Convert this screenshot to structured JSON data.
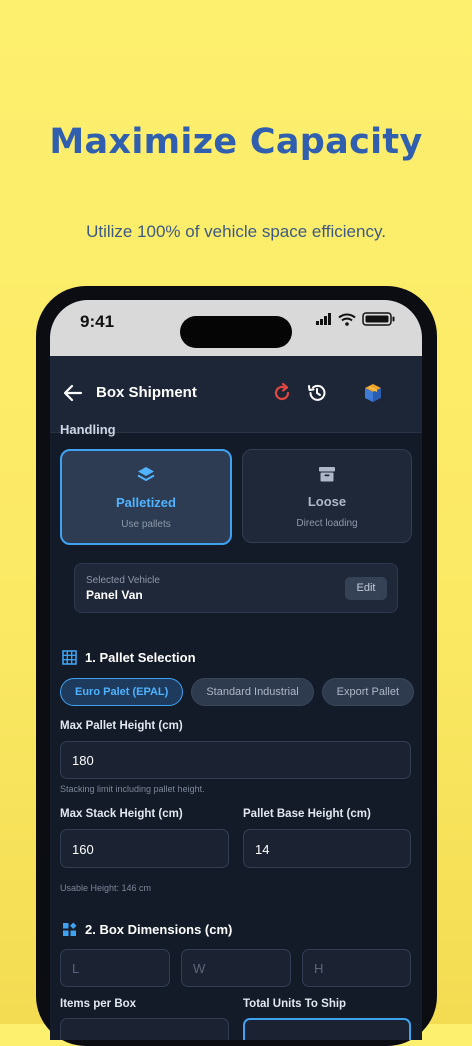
{
  "promo": {
    "headline": "Maximize Capacity",
    "subline": "Utilize 100% of vehicle space efficiency."
  },
  "status_bar": {
    "time": "9:41"
  },
  "app_bar": {
    "title": "Box Shipment",
    "icons": [
      "back-arrow-icon",
      "refresh-icon",
      "history-icon",
      "boxes-logo-icon"
    ],
    "accent_refresh": "#e2473f"
  },
  "handling": {
    "label": "Handling",
    "options": [
      {
        "title": "Palletized",
        "subtitle": "Use pallets",
        "icon": "layers-icon",
        "selected": true
      },
      {
        "title": "Loose",
        "subtitle": "Direct loading",
        "icon": "archive-box-icon",
        "selected": false
      }
    ]
  },
  "vehicle": {
    "label": "Selected Vehicle",
    "value": "Panel Van",
    "edit_label": "Edit"
  },
  "pallet_section": {
    "title": "1. Pallet Selection",
    "chips": [
      {
        "label": "Euro Palet (EPAL)",
        "selected": true
      },
      {
        "label": "Standard Industrial",
        "selected": false
      },
      {
        "label": "Export Pallet",
        "selected": false
      }
    ],
    "max_pallet_height": {
      "label": "Max Pallet Height (cm)",
      "value": "180",
      "hint": "Stacking limit including pallet height."
    },
    "max_stack_height": {
      "label": "Max Stack Height (cm)",
      "value": "160"
    },
    "pallet_base_height": {
      "label": "Pallet Base Height (cm)",
      "value": "14"
    },
    "usable_height": "Usable Height: 146 cm"
  },
  "box_section": {
    "title": "2. Box Dimensions (cm)",
    "placeholders": {
      "l": "L",
      "w": "W",
      "h": "H"
    },
    "items_per_box_label": "Items per Box",
    "total_units_label": "Total Units To Ship"
  },
  "colors": {
    "accent": "#3fa2f0",
    "headline": "#2f5fae",
    "background": "#fdf06e",
    "screen": "#131a28"
  }
}
